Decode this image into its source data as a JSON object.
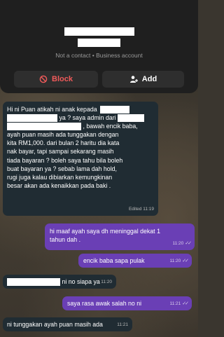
{
  "contact_card": {
    "status_text": "Not a contact • Business account",
    "block_label": "Block",
    "add_label": "Add"
  },
  "messages": [
    {
      "direction": "incoming",
      "line1": "Hi ni Puan atikah ni anak kepada",
      "line2": "ya ? saya admin dari",
      "line3": ",  bawah encik baba,",
      "body": "ayah puan masih ada tunggakan dengan\nkita RM1,000. dari bulan 2 haritu dia kata\nnak bayar, tapi sampai sekarang masih\ntiada bayaran ? boleh saya tahu bila boleh\nbuat bayaran ya ? sebab lama dah hold,\nrugi juga kalau dibiarkan kemungkinan\nbesar akan ada kenaikkan pada baki .",
      "time": "Edited 11:19"
    },
    {
      "direction": "outgoing",
      "text": "hi maaf ayah saya dh meninggal dekat 1\ntahun dah .",
      "time": "11:20"
    },
    {
      "direction": "outgoing",
      "text": "encik baba sapa pulak",
      "time": "11:20"
    },
    {
      "direction": "incoming",
      "text": "ni no siapa ya",
      "time": "11:20"
    },
    {
      "direction": "outgoing",
      "text": "saya rasa awak salah no ni",
      "time": "11:21"
    },
    {
      "direction": "incoming",
      "text": "ni tunggakan ayah puan masih ada",
      "time": "11:21"
    }
  ],
  "icons": {
    "block": "block-icon",
    "add": "add-person-icon",
    "read_ticks": "double-check-icon"
  },
  "colors": {
    "incoming_bubble": "#202c33",
    "outgoing_bubble": "#6a3fb5",
    "block_red": "#f05a5a"
  }
}
